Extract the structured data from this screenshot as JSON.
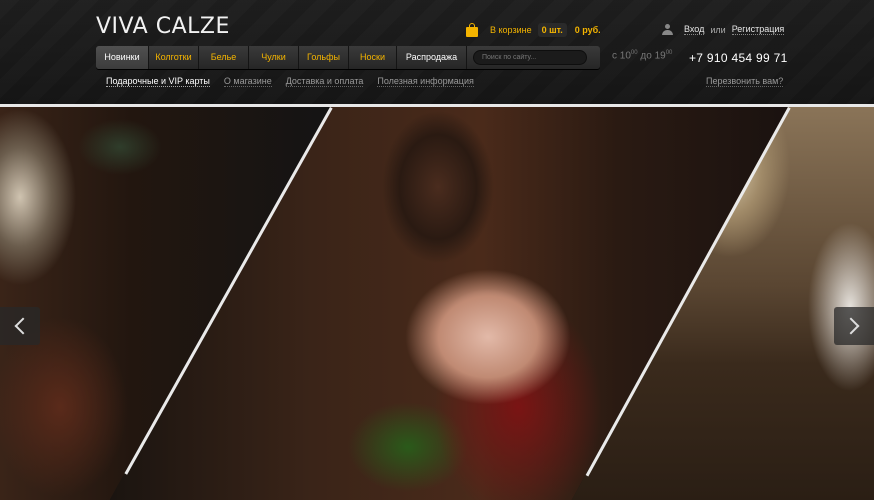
{
  "logo": "VIVA CALZE",
  "cart": {
    "label": "В корзине",
    "count": "0 шт.",
    "sum": "0 руб."
  },
  "auth": {
    "login": "Вход",
    "or": "или",
    "register": "Регистрация"
  },
  "nav": {
    "items": [
      "Новинки",
      "Колготки",
      "Белье",
      "Чулки",
      "Гольфы",
      "Носки",
      "Распродажа"
    ]
  },
  "search": {
    "placeholder": "Поиск по сайту..."
  },
  "hours": {
    "prefix": "с",
    "from": "10",
    "from_min": "00",
    "mid": "до",
    "to": "19",
    "to_min": "00"
  },
  "phone": "+7 910 454 99 71",
  "subnav": {
    "items": [
      "Подарочные и VIP карты",
      "О магазине",
      "Доставка и оплата",
      "Полезная информация"
    ]
  },
  "callback": "Перезвонить вам?",
  "colors": {
    "accent": "#f4b400",
    "background": "#141414"
  },
  "slider": {
    "icons": [
      "chevron-left-icon",
      "chevron-right-icon"
    ]
  }
}
